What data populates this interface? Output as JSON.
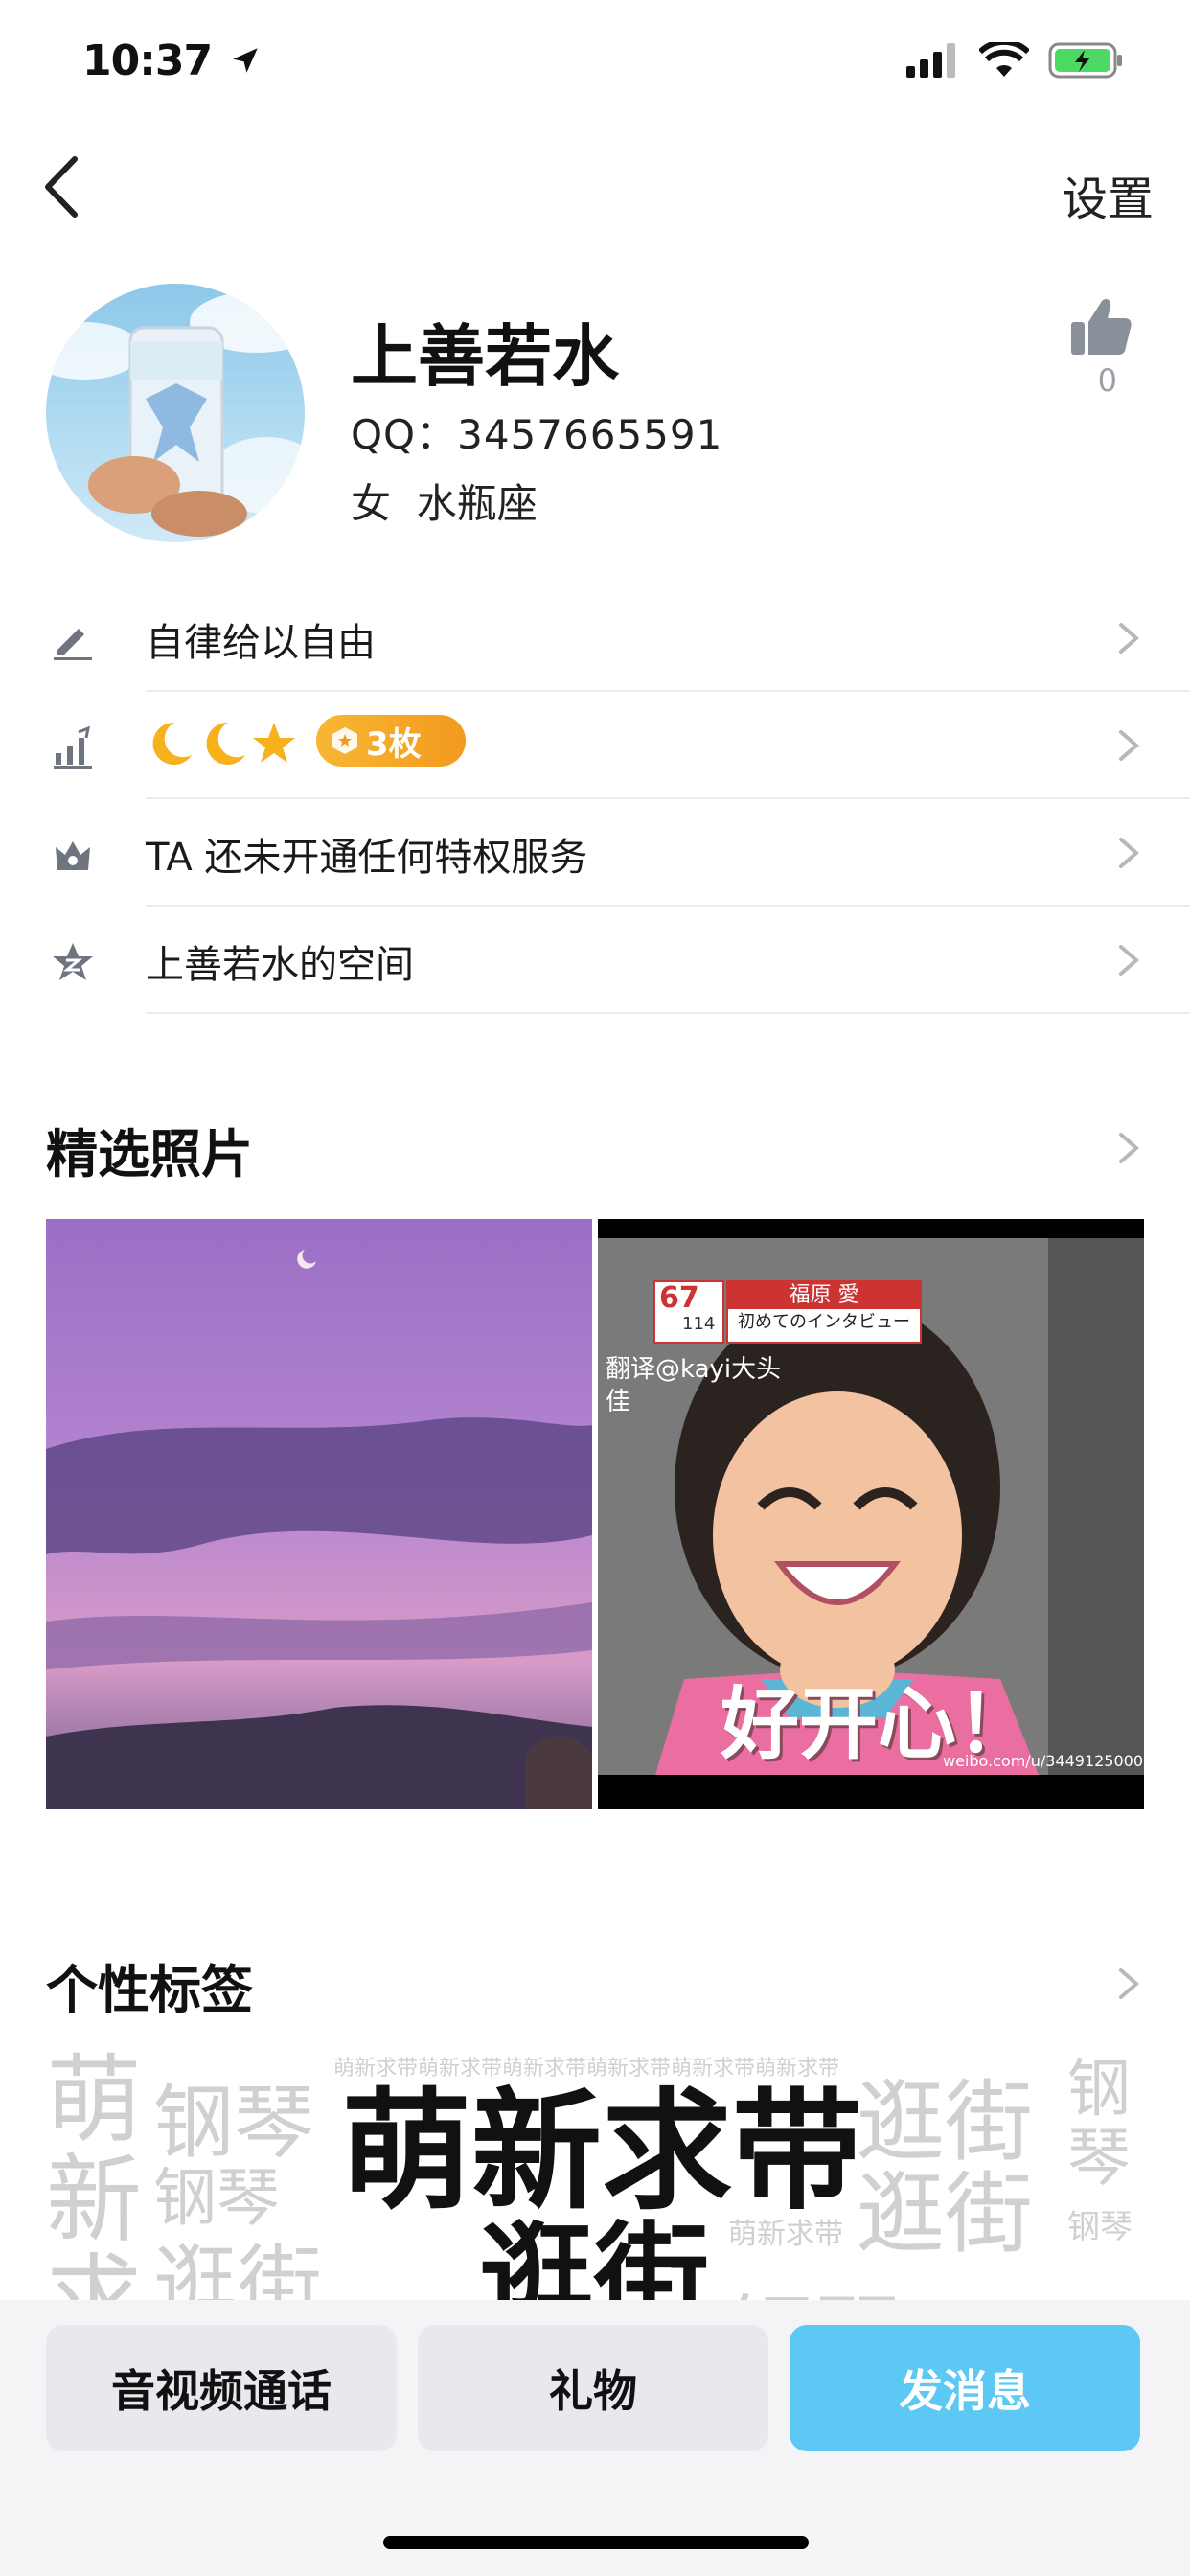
{
  "status_bar": {
    "time": "10:37"
  },
  "nav": {
    "settings_label": "设置"
  },
  "profile": {
    "name": "上善若水",
    "qq": "QQ：3457665591",
    "gender_sign": "女  水瓶座",
    "like_count": "0"
  },
  "rows": [
    {
      "icon": "pencil-icon",
      "label": "自律给以自由"
    },
    {
      "icon": "level-chart-icon",
      "label": "",
      "level_icons": [
        "🌙",
        "🌙",
        "⭐"
      ],
      "badge": "3枚"
    },
    {
      "icon": "crown-icon",
      "label": "TA 还未开通任何特权服务"
    },
    {
      "icon": "star-space-icon",
      "label": "上善若水的空间"
    }
  ],
  "photos_section": {
    "title": "精选照片"
  },
  "photo2": {
    "tv_number": "67",
    "tv_sub": "114",
    "banner_top": "福原 愛",
    "banner_bottom": "初めてのインタビュー",
    "credit": "翻译@kayi大头佳",
    "caption": "好开心！",
    "watermark": "weibo.com/u/3449125000"
  },
  "tags_section": {
    "title": "个性标签",
    "tags": [
      "萌新求带",
      "逛街",
      "钢琴"
    ]
  },
  "bottom_actions": {
    "call_label": "音视频通话",
    "gift_label": "礼物",
    "message_label": "发消息"
  },
  "colors": {
    "accent": "#5ec8f5",
    "badge": "#f5a623",
    "icon_gray": "#6e7480"
  }
}
